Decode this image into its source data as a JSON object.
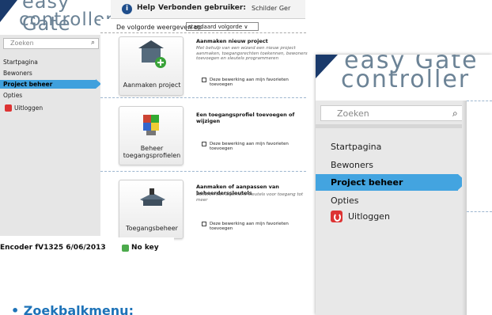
{
  "logo": {
    "line1": "easy Gate",
    "line2": "controller"
  },
  "topbar": {
    "help": "Help",
    "connected_label": "Verbonden gebruiker:",
    "user": "Schilder Ger"
  },
  "sidebar": {
    "search_placeholder": "Zoeken",
    "items": [
      {
        "label": "Startpagina"
      },
      {
        "label": "Bewoners"
      },
      {
        "label": "Project beheer",
        "active": true
      },
      {
        "label": "Opties"
      },
      {
        "label": "Uitloggen",
        "icon": "power-icon"
      }
    ]
  },
  "main": {
    "order_label": "De volgorde weergeven op",
    "order_value": "standaard volgorde",
    "sections": [
      {
        "card_label": "Aanmaken project",
        "title": "Aanmaken nieuw project",
        "description": "Met behulp van een wizard een nieuw project aanmaken, toegangsrechten toekennen, bewoners toevoegen en sleutels programmeren",
        "fav_label": "Deze bewerking aan mijn favorieten toevoegen"
      },
      {
        "card_label": "Beheer toegangsprofielen",
        "title": "Een toegangsprofiel toevoegen of wijzigen",
        "description": "",
        "fav_label": "Deze bewerking aan mijn favorieten toevoegen"
      },
      {
        "card_label": "Toegangsbeheer",
        "title": "Aanmaken of aanpassen van beheerderssleutels",
        "description": "Beheren van algemene sleutels voor toegang tot meer",
        "fav_label": "Deze bewerking aan mijn favorieten toevoegen"
      }
    ]
  },
  "status": {
    "encoder": "Encoder fV1325 6/06/2013",
    "key": "No key"
  },
  "caption": "Zoekbalkmenu:",
  "colors": {
    "accent": "#43a4e0",
    "logo_dark": "#1a3a6b",
    "logo_text": "#6c8396",
    "logout": "#dd3333"
  }
}
